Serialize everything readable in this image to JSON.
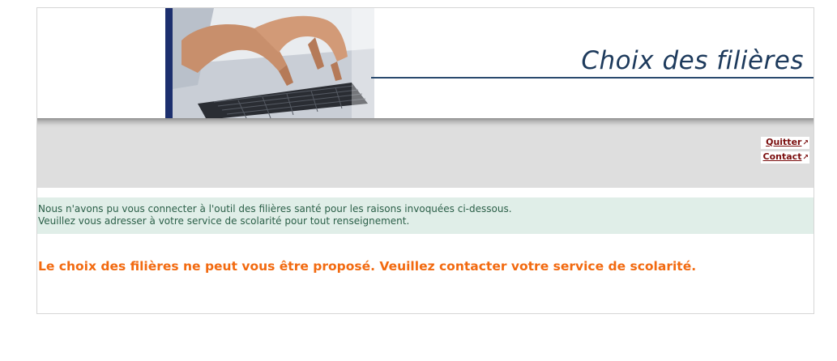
{
  "header": {
    "title": "Choix des filières"
  },
  "nav": {
    "links": [
      {
        "label": "Quitter",
        "icon": "external-link-icon"
      },
      {
        "label": "Contact",
        "icon": "external-link-icon"
      }
    ],
    "ext_glyph": "↗"
  },
  "info": {
    "line1": "Nous n'avons pu vous connecter à l'outil des filières santé pour les raisons invoquées ci-dessous.",
    "line2": "Veuillez vous adresser à votre service de scolarité pour tout renseignement."
  },
  "error": {
    "message": "Le choix des filières ne peut vous être proposé. Veuillez contacter votre service de scolarité."
  },
  "colors": {
    "title": "#1d3a5c",
    "link": "#7a0d0d",
    "info_bg": "#e0eee8",
    "info_text": "#2b5f48",
    "error_text": "#f26a10",
    "nav_bg": "#dedede"
  }
}
